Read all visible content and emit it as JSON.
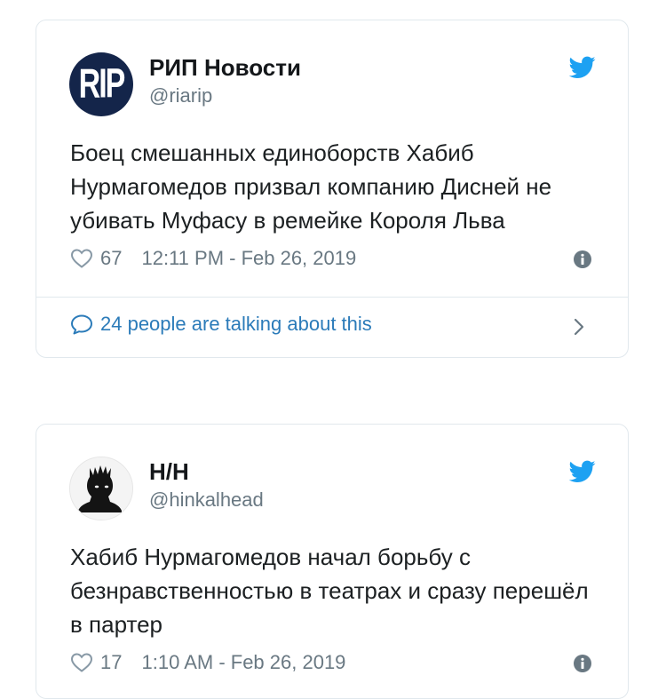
{
  "tweets": [
    {
      "avatar_text": "RIP",
      "name": "РИП Новости",
      "handle": "@riarip",
      "text": "Боец смешанных единоборств Хабиб Нурмагомедов призвал компанию Дисней не убивать Муфасу в ремейке Короля Льва",
      "likes": "67",
      "timestamp": "12:11 PM - Feb 26, 2019",
      "talking": "24 people are talking about this"
    },
    {
      "name": "Н/Н",
      "handle": "@hinkalhead",
      "text": "Хабиб Нурмагомедов начал борьбу с безнравственностью в театрах и сразу перешёл в партер",
      "likes": "17",
      "timestamp": "1:10 AM - Feb 26, 2019"
    }
  ],
  "colors": {
    "twitter_blue": "#1da1f2",
    "link_blue": "#2b7bb9",
    "meta_gray": "#697882",
    "border": "#e1e8ed",
    "rip_avatar_bg": "#14254a"
  },
  "icons": {
    "brand": "twitter-bird-icon",
    "like": "heart-icon",
    "info": "info-icon",
    "conversation": "speech-bubble-icon",
    "more": "chevron-right-icon"
  }
}
